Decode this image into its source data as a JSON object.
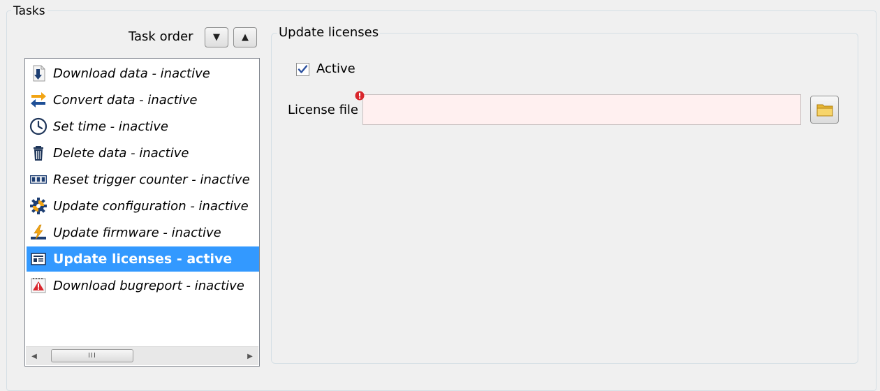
{
  "tasks_group": {
    "title": "Tasks"
  },
  "task_order": {
    "label": "Task order",
    "down_glyph": "▼",
    "up_glyph": "▲"
  },
  "task_list": {
    "items": [
      {
        "label": "Download data - inactive",
        "icon": "download-icon",
        "selected": false
      },
      {
        "label": "Convert data - inactive",
        "icon": "convert-arrows-icon",
        "selected": false
      },
      {
        "label": "Set time - inactive",
        "icon": "clock-icon",
        "selected": false
      },
      {
        "label": "Delete data - inactive",
        "icon": "trash-icon",
        "selected": false
      },
      {
        "label": "Reset trigger counter - inactive",
        "icon": "counter-icon",
        "selected": false
      },
      {
        "label": "Update configuration - inactive",
        "icon": "gear-icon",
        "selected": false
      },
      {
        "label": "Update firmware - inactive",
        "icon": "firmware-lightning-icon",
        "selected": false
      },
      {
        "label": "Update licenses - active",
        "icon": "license-icon",
        "selected": true
      },
      {
        "label": "Download bugreport - inactive",
        "icon": "bugreport-icon",
        "selected": false
      }
    ],
    "scrollbar": {
      "left_glyph": "◀",
      "right_glyph": "▶",
      "thumb_grip": "III"
    }
  },
  "detail": {
    "title": "Update licenses",
    "active_checkbox": {
      "label": "Active",
      "checked": true
    },
    "license_file": {
      "label": "License file",
      "value": "",
      "placeholder": ""
    }
  },
  "colors": {
    "selection": "#3399ff",
    "error_field_bg": "#fff0f0",
    "error_badge": "#d9262c"
  }
}
